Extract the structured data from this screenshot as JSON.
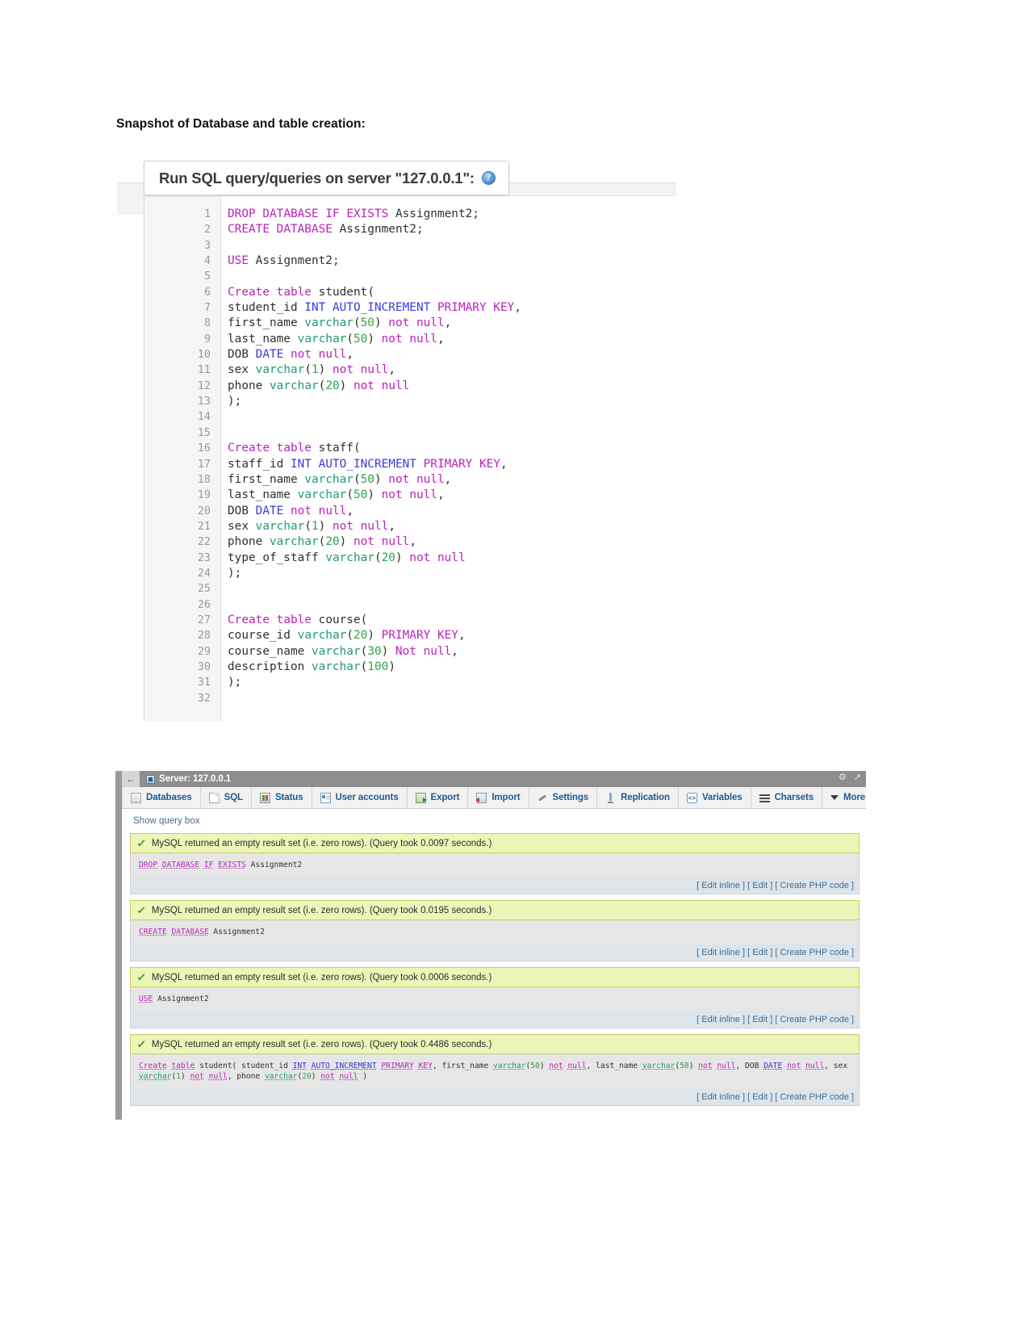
{
  "document": {
    "heading": "Snapshot of Database and table creation:"
  },
  "sql_editor": {
    "title": "Run SQL query/queries on server \"127.0.0.1\":",
    "help_icon_glyph": "?",
    "lines": [
      {
        "n": "1",
        "text": "DROP DATABASE IF EXISTS Assignment2;"
      },
      {
        "n": "2",
        "text": "CREATE DATABASE Assignment2;"
      },
      {
        "n": "3",
        "text": ""
      },
      {
        "n": "4",
        "text": "USE Assignment2;"
      },
      {
        "n": "5",
        "text": ""
      },
      {
        "n": "6",
        "text": "Create table student("
      },
      {
        "n": "7",
        "text": "student_id INT AUTO_INCREMENT PRIMARY KEY,"
      },
      {
        "n": "8",
        "text": "first_name varchar(50) not null,"
      },
      {
        "n": "9",
        "text": "last_name varchar(50) not null,"
      },
      {
        "n": "10",
        "text": "DOB DATE not null,"
      },
      {
        "n": "11",
        "text": "sex varchar(1) not null,"
      },
      {
        "n": "12",
        "text": "phone varchar(20) not null"
      },
      {
        "n": "13",
        "text": ");"
      },
      {
        "n": "14",
        "text": ""
      },
      {
        "n": "15",
        "text": ""
      },
      {
        "n": "16",
        "text": "Create table staff("
      },
      {
        "n": "17",
        "text": "staff_id INT AUTO_INCREMENT PRIMARY KEY,"
      },
      {
        "n": "18",
        "text": "first_name varchar(50) not null,"
      },
      {
        "n": "19",
        "text": "last_name varchar(50) not null,"
      },
      {
        "n": "20",
        "text": "DOB DATE not null,"
      },
      {
        "n": "21",
        "text": "sex varchar(1) not null,"
      },
      {
        "n": "22",
        "text": "phone varchar(20) not null,"
      },
      {
        "n": "23",
        "text": "type_of_staff varchar(20) not null"
      },
      {
        "n": "24",
        "text": ");"
      },
      {
        "n": "25",
        "text": ""
      },
      {
        "n": "26",
        "text": ""
      },
      {
        "n": "27",
        "text": "Create table course("
      },
      {
        "n": "28",
        "text": "course_id varchar(20) PRIMARY KEY,"
      },
      {
        "n": "29",
        "text": "course_name varchar(30) Not null,"
      },
      {
        "n": "30",
        "text": "description varchar(100)"
      },
      {
        "n": "31",
        "text": ");"
      },
      {
        "n": "32",
        "text": ""
      }
    ]
  },
  "phpmyadmin": {
    "server_bar": {
      "back_glyph": "←",
      "server_label": "Server: 127.0.0.1",
      "gear_glyph": "⚙",
      "collapse_glyph": "↗"
    },
    "tabs": [
      {
        "label": "Databases",
        "icon": "databases-icon"
      },
      {
        "label": "SQL",
        "icon": "sql-icon"
      },
      {
        "label": "Status",
        "icon": "status-icon"
      },
      {
        "label": "User accounts",
        "icon": "user-accounts-icon"
      },
      {
        "label": "Export",
        "icon": "export-icon"
      },
      {
        "label": "Import",
        "icon": "import-icon"
      },
      {
        "label": "Settings",
        "icon": "settings-icon"
      },
      {
        "label": "Replication",
        "icon": "replication-icon"
      },
      {
        "label": "Variables",
        "icon": "variables-icon"
      },
      {
        "label": "Charsets",
        "icon": "charsets-icon"
      },
      {
        "label": "More",
        "icon": "chevron-down-icon"
      }
    ],
    "show_query_box": "Show query box",
    "actions": {
      "edit_inline": "[ Edit inline ]",
      "edit": "[ Edit ]",
      "create_php": "[ Create PHP code ]"
    },
    "results": [
      {
        "message": "MySQL returned an empty result set (i.e. zero rows). (Query took 0.0097 seconds.)",
        "query": "DROP DATABASE IF EXISTS Assignment2"
      },
      {
        "message": "MySQL returned an empty result set (i.e. zero rows). (Query took 0.0195 seconds.)",
        "query": "CREATE DATABASE Assignment2"
      },
      {
        "message": "MySQL returned an empty result set (i.e. zero rows). (Query took 0.0006 seconds.)",
        "query": "USE Assignment2"
      },
      {
        "message": "MySQL returned an empty result set (i.e. zero rows). (Query took 0.4486 seconds.)",
        "query": "Create table student( student_id INT AUTO_INCREMENT PRIMARY KEY, first_name varchar(50) not null, last_name varchar(50) not null, DOB DATE not null, sex varchar(1) not null, phone varchar(20) not null )"
      }
    ]
  },
  "colors": {
    "keyword": "#bb22bb",
    "datatype": "#3b3bdc",
    "type": "#1f9c6b",
    "number": "#2fa34a",
    "success_bg": "#eef5b8",
    "server_bar": "#8e8e8e",
    "tab_link": "#235a8c"
  }
}
